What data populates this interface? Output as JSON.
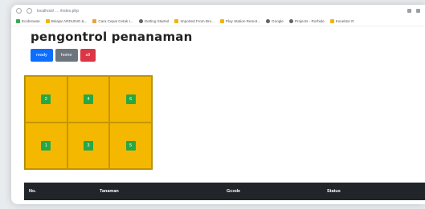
{
  "browser": {
    "url": "localhost/ … /index.php",
    "bookmarks": [
      {
        "label": "Ecobrowse",
        "color": "#34a853"
      },
      {
        "label": "Belajar ARDUINO &...",
        "color": "#f4b400"
      },
      {
        "label": "Cara Cepat Cetak I...",
        "color": "#e8a33d"
      },
      {
        "label": "Getting Started",
        "color": "#5f6368"
      },
      {
        "label": "Imported From Bro...",
        "color": "#f4b400"
      },
      {
        "label": "Play Station Remot...",
        "color": "#f4b400"
      },
      {
        "label": "Google",
        "color": "#5f6368"
      },
      {
        "label": "Projects - Rorhide",
        "color": "#5f6368"
      },
      {
        "label": "Konektor R",
        "color": "#f4b400"
      }
    ]
  },
  "page": {
    "title": "pengontrol penanaman",
    "buttons": {
      "ready": "ready",
      "home": "home",
      "all": "all"
    },
    "cells": [
      "2",
      "4",
      "6",
      "1",
      "3",
      "5"
    ],
    "table": {
      "headers": [
        "No.",
        "Tanaman",
        "Gcode",
        "Status"
      ]
    }
  },
  "colors": {
    "grid_bg": "#f5b800",
    "plant": "#28a745",
    "ready_button": "#0d6efd",
    "home_button": "#6c757d",
    "all_button": "#dc3545",
    "table_header": "#212529"
  }
}
